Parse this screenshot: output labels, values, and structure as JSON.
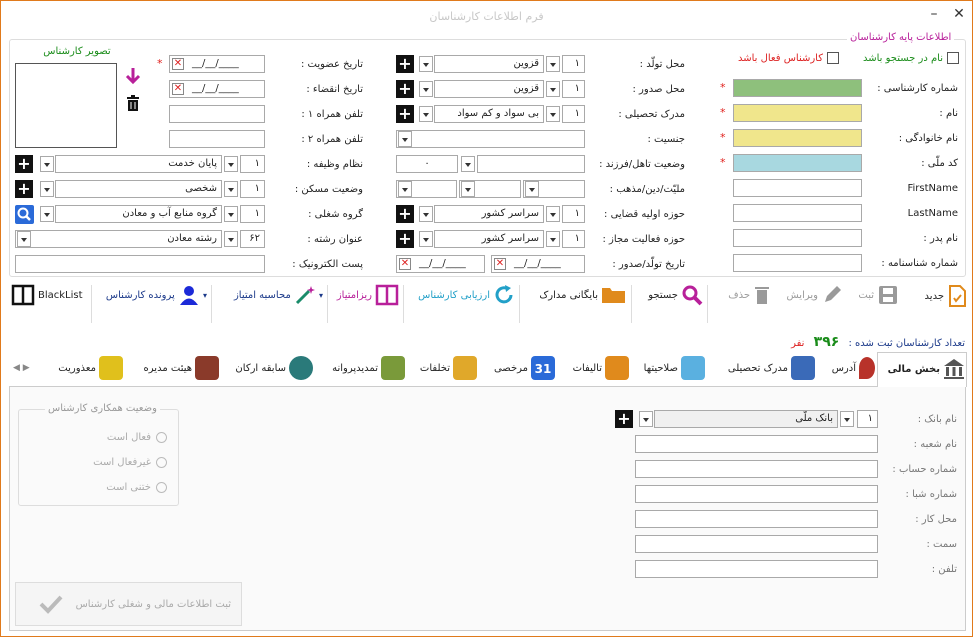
{
  "window": {
    "title": "فرم اطلاعات کارشناسان",
    "min": "–",
    "close": "✕"
  },
  "section": {
    "title": "اطلاعات پایه کارشناسان",
    "photo_label": "تصویر کارشناس"
  },
  "checks": {
    "not_in_search": "نام در جستجو باشد",
    "active": "کارشناس فعال باشد"
  },
  "right_labels": {
    "expert_no": "شماره کارشناسی :",
    "name": "نام :",
    "family": "نام خانوادگی :",
    "national": "کد ملّی :",
    "firstname": "FirstName",
    "lastname": "LastName",
    "father": "نام پدر :",
    "idno": "شماره شناسنامه :"
  },
  "mid_labels": {
    "birth_place": "محل تولّد :",
    "issue_place": "محل صدور :",
    "degree": "مدرک تحصیلی :",
    "gender": "جنسیت :",
    "marital": "وضعیت تاهل/فرزند :",
    "nationality": "ملیّت/دین/مذهب :",
    "judicial": "حوزه اولیه قضایی :",
    "activity": "حوزه فعالیت مجاز :",
    "birth_date": "تاریخ تولّد/صدور :"
  },
  "mid_values": {
    "birth_code": "۱",
    "birth_city": "قزوین",
    "issue_code": "۱",
    "issue_city": "قزوین",
    "degree_code": "۱",
    "degree_text": "بی سواد و کم سواد",
    "children": "۰",
    "judicial_code": "۱",
    "judicial_text": "سراسر کشور",
    "activity_code": "۱",
    "activity_text": "سراسر کشور",
    "date_a": "__/__/____",
    "date_b": "__/__/____"
  },
  "left_labels": {
    "membership": "تاریخ عضویت :",
    "expire": "تاریخ انقضاء :",
    "mobile1": "تلفن همراه ۱ :",
    "mobile2": "تلفن همراه ۲ :",
    "duty": "نظام وظیفه :",
    "housing": "وضعیت مسکن :",
    "job_group": "گروه شغلی :",
    "field": "عنوان رشته :",
    "email": "پست الکترونیک :"
  },
  "left_values": {
    "membership_date": "__/__/____",
    "expire_date": "__/__/____",
    "duty_code": "۱",
    "duty_text": "پایان خدمت",
    "housing_code": "۱",
    "housing_text": "شخصی",
    "job_code": "۱",
    "job_text": "گروه منابع آب و معادن",
    "field_code": "۶۲",
    "field_text": "رشته معادن"
  },
  "toolbar": [
    {
      "id": "new",
      "label": "جدید",
      "color": "#e08a1c"
    },
    {
      "id": "save",
      "label": "ثبت",
      "color": "#888"
    },
    {
      "id": "edit",
      "label": "ویرایش",
      "color": "#888"
    },
    {
      "id": "delete",
      "label": "حذف",
      "color": "#888"
    },
    {
      "id": "search",
      "label": "جستجو",
      "color": "#b8209a"
    },
    {
      "id": "archive",
      "label": "بایگانی مدارک",
      "color": "#b8209a"
    },
    {
      "id": "evaluate",
      "label": "ارزیابی کارشناس",
      "color": "#22a0c8"
    },
    {
      "id": "detail",
      "label": "ریزامتیاز",
      "color": "#b8209a"
    },
    {
      "id": "score",
      "label": "محاسبه امتیاز",
      "color": "#1c3a8a"
    },
    {
      "id": "file",
      "label": "پرونده کارشناس",
      "color": "#1c3a8a"
    },
    {
      "id": "blacklist",
      "label": "BlackList",
      "color": "#111"
    }
  ],
  "count": {
    "label": "تعداد کارشناسان ثبت شده :",
    "value": "۳۹۶",
    "unit": "نفر"
  },
  "tabs": [
    "بخش مالی",
    "آدرس",
    "مدرک تحصیلی",
    "صلاحیتها",
    "تالیفات",
    "مرخصی",
    "تخلفات",
    "تمدیدپروانه",
    "سابقه ارکان",
    "هیئت مدیره",
    "معذوریت"
  ],
  "finance": {
    "labels": [
      "نام بانک :",
      "نام شعبه :",
      "شماره حساب :",
      "شماره شبا :",
      "محل کار :",
      "سمت :",
      "تلفن :"
    ],
    "bank_code": "۱",
    "bank_name": "بانک ملّی"
  },
  "cooperation": {
    "title": "وضعیت همکاری کارشناس",
    "options": [
      "فعال است",
      "غیرفعال است",
      "ختنی است"
    ]
  },
  "submit_label": "ثبت اطلاعات مالی و شغلی کارشناس"
}
